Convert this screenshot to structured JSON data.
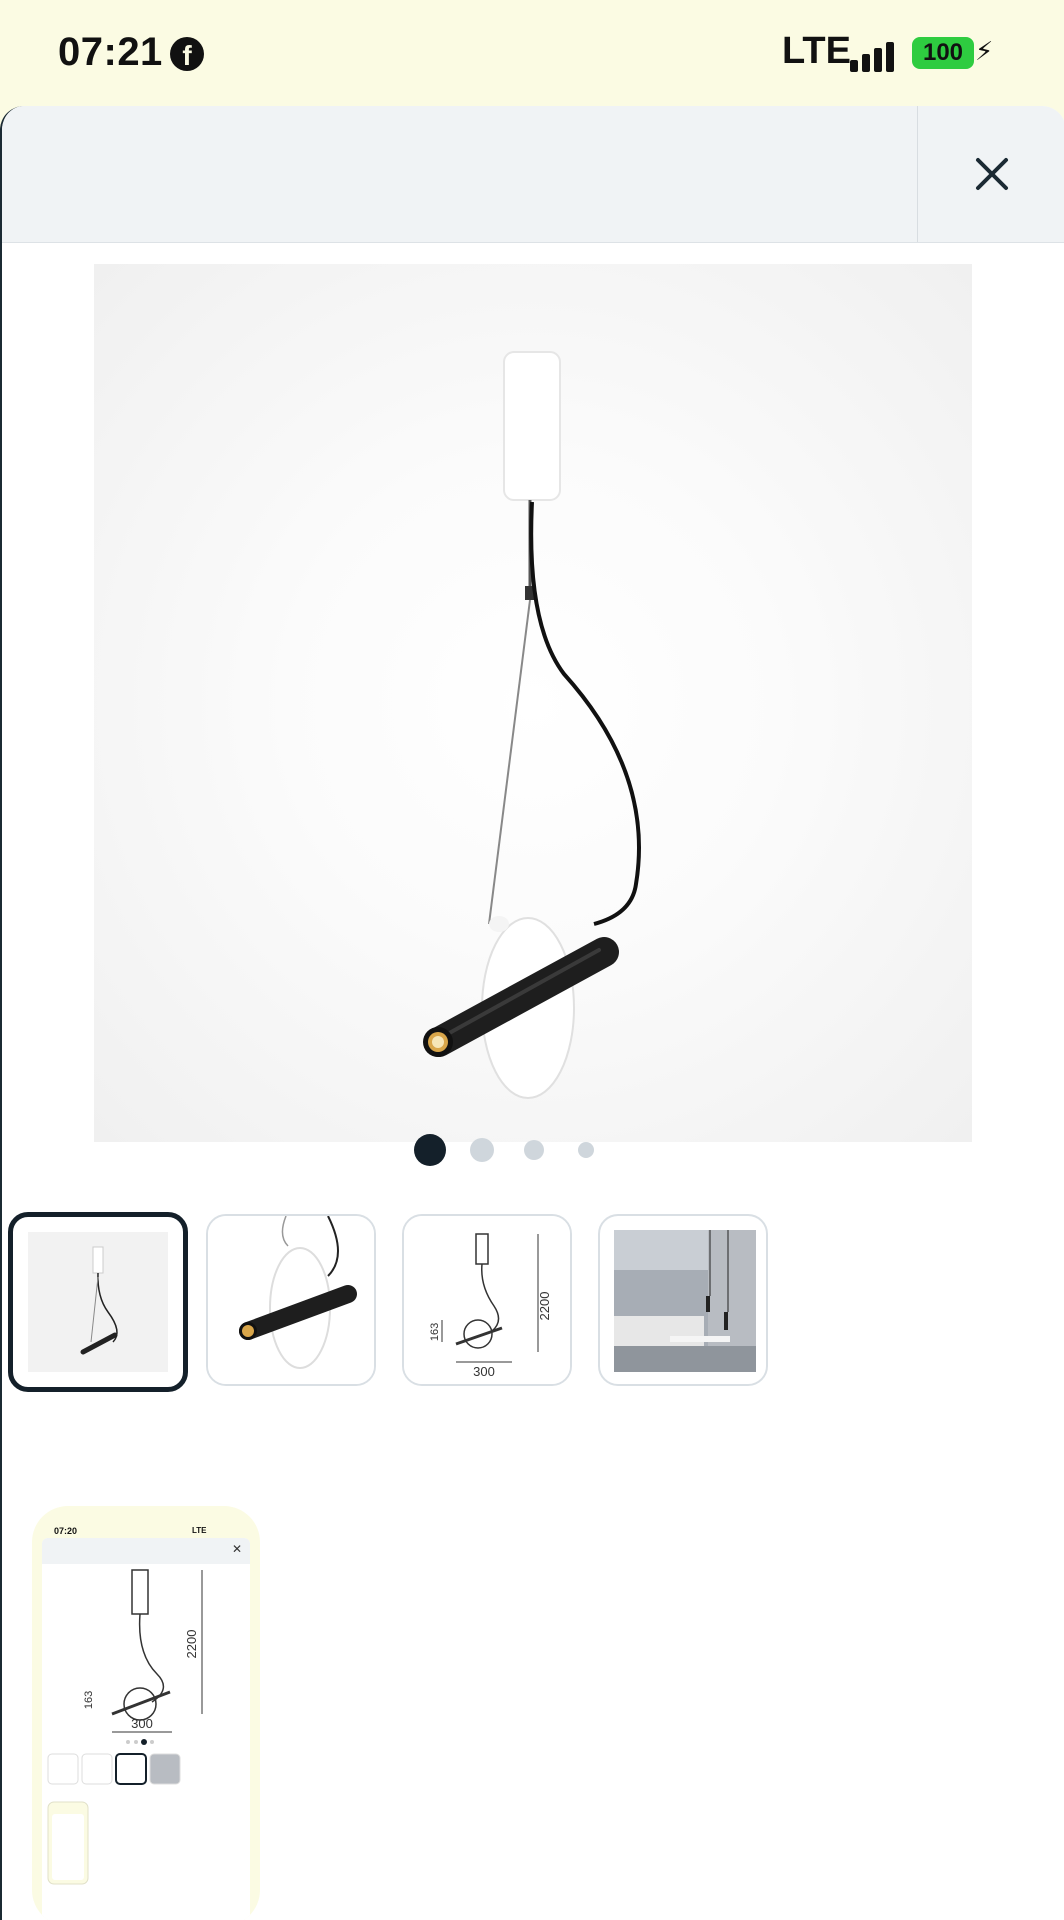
{
  "status_bar": {
    "time": "07:21",
    "app_icon": "facebook-icon",
    "network": "LTE",
    "battery": "100",
    "charging_icon": "bolt-icon"
  },
  "header": {
    "close_icon": "close-icon"
  },
  "gallery": {
    "page_count": 4,
    "active_index": 0,
    "thumbnails": [
      {
        "name": "pendant-lamp-full-view"
      },
      {
        "name": "pendant-lamp-closeup"
      },
      {
        "name": "pendant-lamp-dimensions"
      },
      {
        "name": "pendant-lamp-interior"
      }
    ],
    "dimension_labels": {
      "height": "2200",
      "width": "300",
      "offset": "163"
    }
  },
  "preview": {
    "time": "07:20",
    "network": "LTE"
  },
  "colors": {
    "status_bg": "#fbfbe3",
    "header_bg": "#f0f3f5",
    "active_dot": "#14202a",
    "inactive_dot": "#cfd6dc",
    "battery": "#2ecc40"
  }
}
